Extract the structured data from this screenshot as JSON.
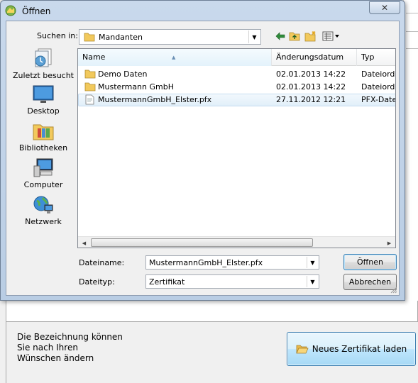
{
  "dialog": {
    "title": "Öffnen",
    "close_glyph": "✕",
    "look_in_label": "Suchen in:",
    "look_in_value": "Mandanten",
    "toolbar_icons": [
      "back-arrow-icon",
      "up-folder-icon",
      "new-folder-icon",
      "view-menu-icon"
    ]
  },
  "places": [
    {
      "label": "Zuletzt besucht",
      "icon": "recent-places-icon"
    },
    {
      "label": "Desktop",
      "icon": "desktop-icon"
    },
    {
      "label": "Bibliotheken",
      "icon": "libraries-icon"
    },
    {
      "label": "Computer",
      "icon": "computer-icon"
    },
    {
      "label": "Netzwerk",
      "icon": "network-icon"
    }
  ],
  "filelist": {
    "columns": [
      "Name",
      "Änderungsdatum",
      "Typ"
    ],
    "rows": [
      {
        "name": "Demo Daten",
        "date": "02.01.2013 14:22",
        "type": "Dateiordn",
        "icon": "folder-icon"
      },
      {
        "name": "Mustermann GmbH",
        "date": "02.01.2013 14:22",
        "type": "Dateiordn",
        "icon": "folder-icon"
      },
      {
        "name": "MustermannGmbH_Elster.pfx",
        "date": "27.11.2012 12:21",
        "type": "PFX-Datei",
        "icon": "file-icon",
        "selected": true
      }
    ]
  },
  "fields": {
    "filename_label": "Dateiname:",
    "filename_value": "MustermannGmbH_Elster.pfx",
    "filetype_label": "Dateityp:",
    "filetype_value": "Zertifikat",
    "open_button": "Öffnen",
    "cancel_button": "Abbrechen"
  },
  "background": {
    "hint_lines": [
      "Die Bezeichnung können",
      "Sie nach Ihren",
      "Wünschen ändern"
    ],
    "new_cert_button": "Neues Zertifikat laden",
    "accent": "#3c7fb1"
  }
}
